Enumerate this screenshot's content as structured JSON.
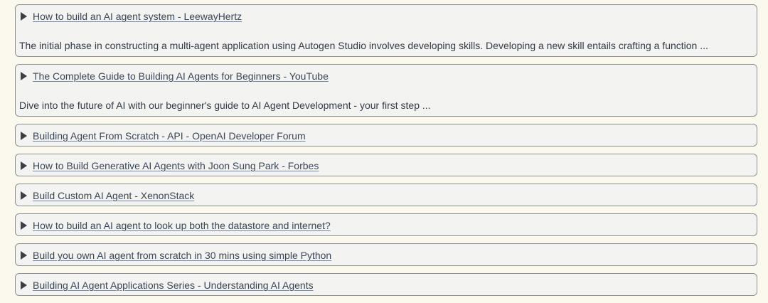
{
  "results": [
    {
      "title": "How to build an AI agent system - LeewayHertz",
      "description": "The initial phase in constructing a multi-agent application using Autogen Studio involves developing skills. Developing a new skill entails crafting a function ..."
    },
    {
      "title": "The Complete Guide to Building AI Agents for Beginners - YouTube",
      "description": "Dive into the future of AI with our beginner's guide to AI Agent Development - your first step ..."
    },
    {
      "title": "Building Agent From Scratch - API - OpenAI Developer Forum"
    },
    {
      "title": "How to Build Generative AI Agents with Joon Sung Park - Forbes"
    },
    {
      "title": "Build Custom AI Agent - XenonStack"
    },
    {
      "title": "How to build an AI agent to look up both the datastore and internet?"
    },
    {
      "title": "Build you own AI agent from scratch in 30 mins using simple Python"
    },
    {
      "title": "Building AI Agent Applications Series - Understanding AI Agents"
    }
  ]
}
